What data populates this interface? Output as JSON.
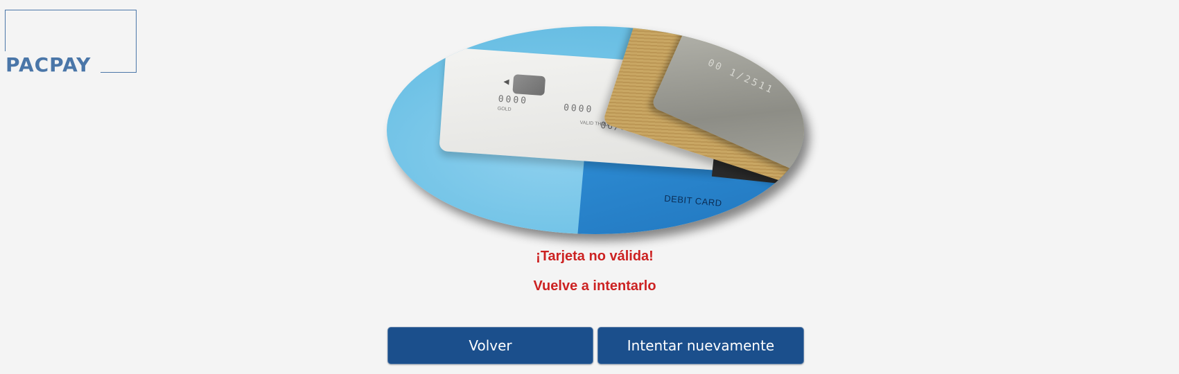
{
  "logo": {
    "text": "PACPAY"
  },
  "hero": {
    "image": "credit-cards-photo",
    "card_label": "DEBIT CARD",
    "white_card_digits_1": "0000",
    "white_card_digits_2": "0000",
    "white_card_gold": "GOLD",
    "white_card_valid": "VALID THRU",
    "white_card_date": "06/21",
    "silver_card_digits": "00 1/2511"
  },
  "messages": {
    "error_title": "¡Tarjeta no válida!",
    "error_hint": "Vuelve a intentarlo"
  },
  "buttons": {
    "back_label": "Volver",
    "retry_label": "Intentar nuevamente"
  },
  "colors": {
    "brand": "#4a76a8",
    "button_bg": "#1b4f8c",
    "error_text": "#cc2222",
    "background": "#f4f4f4"
  }
}
